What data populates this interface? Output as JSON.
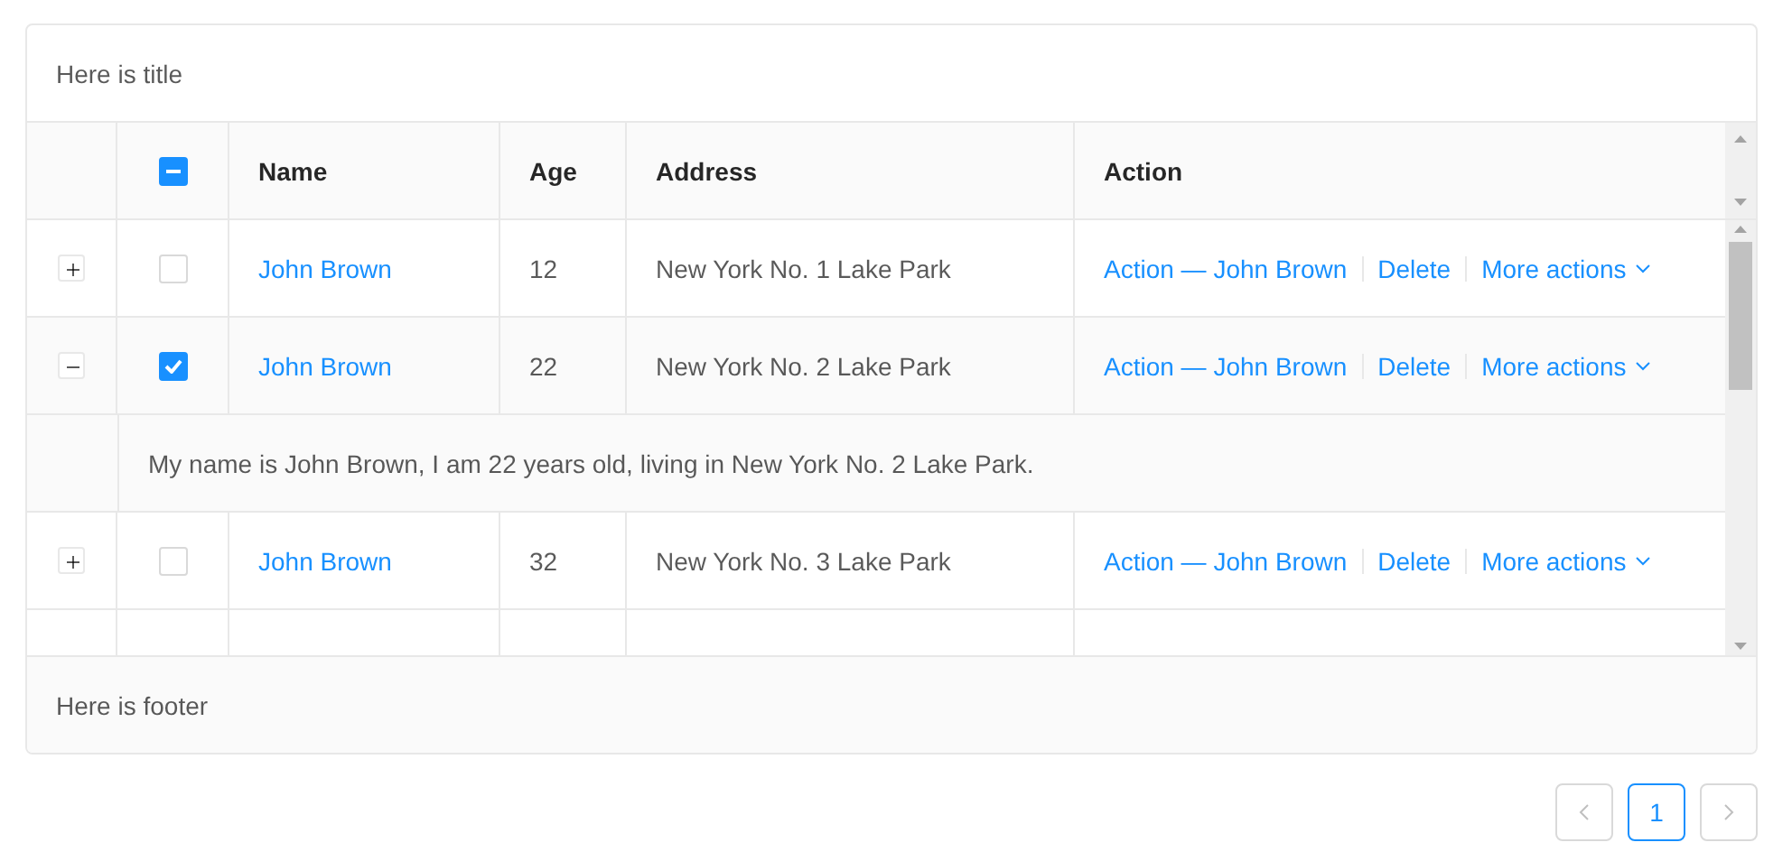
{
  "title": "Here is title",
  "header": {
    "select_all": {
      "checked": true,
      "indeterminate": true
    },
    "columns": [
      "Name",
      "Age",
      "Address",
      "Action"
    ]
  },
  "rows": [
    {
      "expanded": false,
      "selected": false,
      "name": "John Brown",
      "age": "12",
      "address": "New York No. 1 Lake Park",
      "actions": [
        "Action — John Brown",
        "Delete",
        "More actions"
      ]
    },
    {
      "expanded": true,
      "selected": true,
      "name": "John Brown",
      "age": "22",
      "address": "New York No. 2 Lake Park",
      "actions": [
        "Action — John Brown",
        "Delete",
        "More actions"
      ],
      "description": "My name is John Brown, I am 22 years old, living in New York No. 2 Lake Park."
    },
    {
      "expanded": false,
      "selected": false,
      "name": "John Brown",
      "age": "32",
      "address": "New York No. 3 Lake Park",
      "actions": [
        "Action — John Brown",
        "Delete",
        "More actions"
      ]
    }
  ],
  "footer": "Here is footer",
  "pagination": {
    "prev": {
      "disabled": true
    },
    "pages": [
      {
        "label": "1",
        "selected": true
      }
    ],
    "next": {
      "disabled": true
    }
  }
}
